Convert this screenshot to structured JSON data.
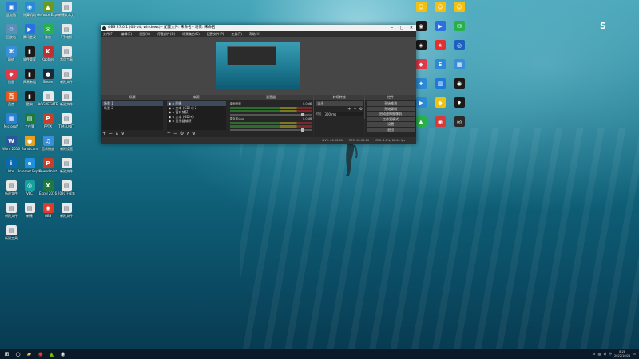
{
  "desktop": {
    "left_icons": [
      {
        "label": "此电脑",
        "color": "#2f7fd6",
        "glyph": "▣"
      },
      {
        "label": "计算机助",
        "color": "#2a8ad6",
        "glyph": "◉"
      },
      {
        "label": "GeForce Experience",
        "color": "#6b9b1e",
        "glyph": "▲"
      },
      {
        "label": "新建文本文",
        "color": "#e8e8e8",
        "glyph": "▤"
      },
      {
        "label": "回收站",
        "color": "#5a8fb8",
        "glyph": "♲"
      },
      {
        "label": "腾讯会议",
        "color": "#2a70e0",
        "glyph": "▶"
      },
      {
        "label": "微信",
        "color": "#28b04a",
        "glyph": "✉"
      },
      {
        "label": "1手电影",
        "color": "#e8e8e8",
        "glyph": "▤"
      },
      {
        "label": "网络",
        "color": "#3a8ed8",
        "glyph": "⌘"
      },
      {
        "label": "软件管家",
        "color": "#1a1a1a",
        "glyph": "▮"
      },
      {
        "label": "Kapture",
        "color": "#c03030",
        "glyph": "K"
      },
      {
        "label": "常用工具",
        "color": "#e8e8e8",
        "glyph": "▤"
      },
      {
        "label": "迅雷",
        "color": "#e03a4a",
        "glyph": "◆"
      },
      {
        "label": "网易有道",
        "color": "#1a1a1a",
        "glyph": "▮"
      },
      {
        "label": "Steam",
        "color": "#1b2838",
        "glyph": "●"
      },
      {
        "label": "新建文件",
        "color": "#e8e8e8",
        "glyph": "▤"
      },
      {
        "label": "百度",
        "color": "#e05a20",
        "glyph": "百"
      },
      {
        "label": "酷狗",
        "color": "#1a1a1a",
        "glyph": "▮"
      },
      {
        "label": "AGGREGATE",
        "color": "#e8e8e8",
        "glyph": "▤"
      },
      {
        "label": "新建文件",
        "color": "#e8e8e8",
        "glyph": "▤"
      },
      {
        "label": "Microsoft",
        "color": "#2a7fd6",
        "glyph": "▦"
      },
      {
        "label": "工作簿",
        "color": "#1e7a3e",
        "glyph": "▤"
      },
      {
        "label": "PPTX",
        "color": "#c4402a",
        "glyph": "P"
      },
      {
        "label": "TIMEUNIT",
        "color": "#e8e8e8",
        "glyph": "▤"
      },
      {
        "label": "Word 2016",
        "color": "#2b579a",
        "glyph": "W"
      },
      {
        "label": "Bandicam",
        "color": "#e8a020",
        "glyph": "●"
      },
      {
        "label": "音乐播放",
        "color": "#3a8ed8",
        "glyph": "♫"
      },
      {
        "label": "新建设置",
        "color": "#e8e8e8",
        "glyph": "▤"
      },
      {
        "label": "Intel",
        "color": "#0a6ab0",
        "glyph": "i"
      },
      {
        "label": "Internet Explorer",
        "color": "#1e90e0",
        "glyph": "e"
      },
      {
        "label": "PowerPoint",
        "color": "#c4402a",
        "glyph": "P"
      },
      {
        "label": "新建文件",
        "color": "#e8e8e8",
        "glyph": "▤"
      },
      {
        "label": "新建文件",
        "color": "#e8e8e8",
        "glyph": "▤"
      },
      {
        "label": "VLC",
        "color": "#18a0a0",
        "glyph": "◎"
      },
      {
        "label": "Excel 2016",
        "color": "#1e7a3e",
        "glyph": "X"
      },
      {
        "label": "2020下半年",
        "color": "#e8e8e8",
        "glyph": "▤"
      },
      {
        "label": "新建文件",
        "color": "#e8e8e8",
        "glyph": "▤"
      },
      {
        "label": "新建",
        "color": "#e8e8e8",
        "glyph": "▤"
      },
      {
        "label": "OBS",
        "color": "#e03a2a",
        "glyph": "◉"
      },
      {
        "label": "新建文件",
        "color": "#e8e8e8",
        "glyph": "▤"
      },
      {
        "label": "新建工具",
        "color": "#e8e8e8",
        "glyph": "▤"
      }
    ],
    "right_icons": [
      {
        "label": "",
        "color": "#f2c012",
        "glyph": "☺"
      },
      {
        "label": "",
        "color": "#f2c012",
        "glyph": "☺"
      },
      {
        "label": "",
        "color": "#f2c012",
        "glyph": "☺"
      },
      {
        "label": "",
        "color": "#1a1a1a",
        "glyph": "◉"
      },
      {
        "label": "",
        "color": "#2a70e0",
        "glyph": "▶"
      },
      {
        "label": "",
        "color": "#28b04a",
        "glyph": "✉"
      },
      {
        "label": "",
        "color": "#1a1a1a",
        "glyph": "◈"
      },
      {
        "label": "",
        "color": "#e03030",
        "glyph": "★"
      },
      {
        "label": "",
        "color": "#1e60c0",
        "glyph": "◎"
      },
      {
        "label": "",
        "color": "#e03a4a",
        "glyph": "◆"
      },
      {
        "label": "",
        "color": "#2a8ad6",
        "glyph": "S"
      },
      {
        "label": "",
        "color": "#3a8ed8",
        "glyph": "▦"
      },
      {
        "label": "",
        "color": "#2a8ad6",
        "glyph": "✦"
      },
      {
        "label": "",
        "color": "#1e7ad6",
        "glyph": "▥"
      },
      {
        "label": "",
        "color": "#1a1a1a",
        "glyph": "◉"
      },
      {
        "label": "",
        "color": "#2a8ad6",
        "glyph": "▶"
      },
      {
        "label": "",
        "color": "#f2c012",
        "glyph": "◆"
      },
      {
        "label": "",
        "color": "#1a1a1a",
        "glyph": "♦"
      },
      {
        "label": "",
        "color": "#28b04a",
        "glyph": "▲"
      },
      {
        "label": "",
        "color": "#d83a3a",
        "glyph": "◉"
      },
      {
        "label": "",
        "color": "#2a2a2a",
        "glyph": "◎"
      }
    ],
    "right_s_icon": {
      "glyph": "S",
      "color": "#3a9ad6"
    }
  },
  "obs": {
    "title": "OBS 27.0.1 (64-bit, windows) - 配置文件: 未命名 - 场景: 未命名",
    "menu": [
      "文件(F)",
      "编辑(E)",
      "视图(V)",
      "停靠部件(D)",
      "场景集合(S)",
      "配置文件(P)",
      "工具(T)",
      "帮助(H)"
    ],
    "docks": {
      "scenes": {
        "header": "场景",
        "items": [
          "场景 1",
          "场景 2"
        ],
        "selected": 0
      },
      "sources": {
        "header": "来源",
        "items": [
          "图像",
          "文本 (GDI+) 2",
          "窗口捕获",
          "文本 (GDI+)",
          "显示器捕获"
        ],
        "selected": 0
      },
      "mixer": {
        "header": "混音器",
        "tracks": [
          {
            "name": "桌面音频",
            "db": "0.0 dB"
          },
          {
            "name": "麦克风/Aux",
            "db": "0.0 dB"
          }
        ]
      },
      "transitions": {
        "header": "转场特效",
        "type": "淡出",
        "duration_label": "时长",
        "duration": "300 ms"
      },
      "controls": {
        "header": "控件",
        "buttons": [
          "开始推流",
          "开始录制",
          "启动虚拟摄像机",
          "工作室模式",
          "设置",
          "退出"
        ]
      }
    },
    "status": {
      "live": "LIVE: 00:00:00",
      "rec": "REC: 00:00:00",
      "cpu": "CPU: 1.1%, 60.00 fps"
    }
  },
  "taskbar": {
    "items": [
      {
        "name": "start",
        "glyph": "⊞",
        "color": "#ffffff"
      },
      {
        "name": "search",
        "glyph": "○",
        "color": "#ffffff"
      },
      {
        "name": "explorer",
        "glyph": "▰",
        "color": "#f0c040"
      },
      {
        "name": "chrome",
        "glyph": "◉",
        "color": "#e04030"
      },
      {
        "name": "geforce",
        "glyph": "▲",
        "color": "#76b900"
      },
      {
        "name": "obs",
        "glyph": "◉",
        "color": "#dddddd"
      }
    ],
    "time": "8:28",
    "date": "2022/10/21"
  }
}
